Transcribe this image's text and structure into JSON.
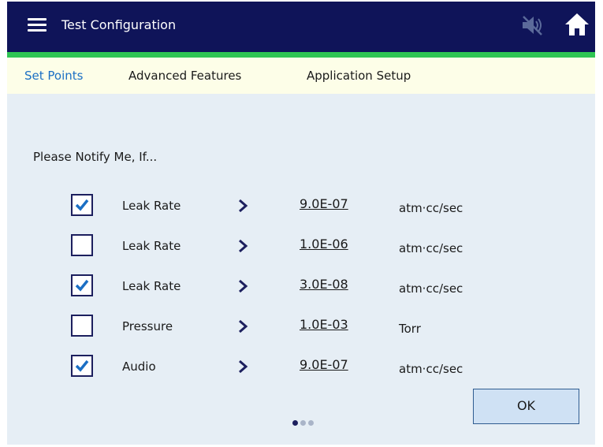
{
  "header": {
    "title": "Test Configuration",
    "menu_icon": "hamburger-menu-icon",
    "mute_icon": "speaker-muted-icon",
    "home_icon": "home-icon"
  },
  "tabs": [
    {
      "label": "Set Points",
      "active": true
    },
    {
      "label": "Advanced Features",
      "active": false
    },
    {
      "label": "Application Setup",
      "active": false
    }
  ],
  "notify_label": "Please Notify Me, If...",
  "rows": [
    {
      "checked": true,
      "label": "Leak Rate",
      "value": "9.0E-07",
      "unit": "atm·cc/sec"
    },
    {
      "checked": false,
      "label": "Leak Rate",
      "value": "1.0E-06",
      "unit": "atm·cc/sec"
    },
    {
      "checked": true,
      "label": "Leak Rate",
      "value": "3.0E-08",
      "unit": "atm·cc/sec"
    },
    {
      "checked": false,
      "label": "Pressure",
      "value": "1.0E-03",
      "unit": "Torr"
    },
    {
      "checked": true,
      "label": "Audio",
      "value": "9.0E-07",
      "unit": "atm·cc/sec"
    }
  ],
  "ok_label": "OK",
  "pagination": {
    "total": 3,
    "current": 1
  },
  "colors": {
    "header_bg": "#0f1459",
    "accent_green": "#2fc553",
    "active_tab": "#1b6fc4",
    "content_bg": "#e6eef5",
    "checkmark": "#1b6fc4"
  }
}
